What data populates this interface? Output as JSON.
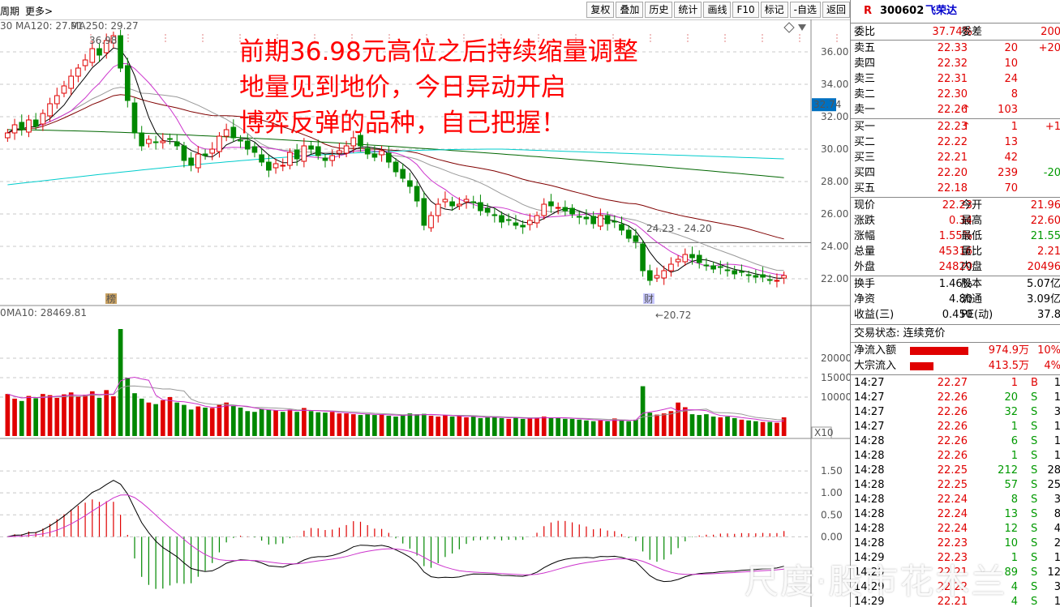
{
  "toolbar": {
    "period_label": "周期",
    "more_label": "更多>",
    "buttons": [
      "复权",
      "叠加",
      "历史",
      "统计",
      "画线",
      "F10",
      "标记",
      "-自选",
      "返回"
    ]
  },
  "ma_legend": {
    "first": "30",
    "ma120": "MA120: 27.91",
    "ma250": "MA250: 29.27"
  },
  "vol_legend": {
    "first": "0",
    "ma10": "MA10: 28469.81",
    "badge": "X10"
  },
  "price_axis": [
    "36.00",
    "34.00",
    "32.00",
    "30.00",
    "28.00",
    "26.00",
    "24.00",
    "22.00"
  ],
  "current_price_tag": "32.74",
  "vol_axis": [
    "20000",
    "15000",
    "10000"
  ],
  "macd_axis": [
    "1.50",
    "1.00",
    "0.50",
    "0.00"
  ],
  "chart_annotations": {
    "high_label": "36.98",
    "low_label": "←20.72",
    "range_label": "24.23 - 24.20",
    "bang_marker": "榜",
    "cai_marker": "财"
  },
  "annotation_text": [
    "前期36.98元高位之后持续缩量调整",
    "地量见到地价，今日异动开启",
    "博弈反弹的品种，自己把握！"
  ],
  "watermark": "尺度·股市花木兰",
  "stock": {
    "code": "300602",
    "name": "飞荣达",
    "badge": "R"
  },
  "ratio": {
    "l1": "委比",
    "v1": "37.74%",
    "l2": "委差",
    "v2": "200"
  },
  "sells": [
    {
      "label": "卖五",
      "price": "22.33",
      "vol": "20",
      "chg": "+20"
    },
    {
      "label": "卖四",
      "price": "22.32",
      "vol": "10",
      "chg": ""
    },
    {
      "label": "卖三",
      "price": "22.31",
      "vol": "24",
      "chg": ""
    },
    {
      "label": "卖二",
      "price": "22.30",
      "vol": "8",
      "chg": ""
    },
    {
      "label": "卖一",
      "price": "22.26",
      "vol": "103",
      "chg": "",
      "arrow": "↑"
    }
  ],
  "buys": [
    {
      "label": "买一",
      "price": "22.23",
      "vol": "1",
      "chg": "+1",
      "arrow": "↑"
    },
    {
      "label": "买二",
      "price": "22.22",
      "vol": "13",
      "chg": ""
    },
    {
      "label": "买三",
      "price": "22.21",
      "vol": "42",
      "chg": ""
    },
    {
      "label": "买四",
      "price": "22.20",
      "vol": "239",
      "chg": "-20"
    },
    {
      "label": "买五",
      "price": "22.18",
      "vol": "70",
      "chg": ""
    }
  ],
  "quote": [
    {
      "l1": "现价",
      "v1": "22.23",
      "l2": "今开",
      "v2": "21.96"
    },
    {
      "l1": "涨跌",
      "v1": "0.34",
      "l2": "最高",
      "v2": "22.60"
    },
    {
      "l1": "涨幅",
      "v1": "1.55%",
      "l2": "最低",
      "v2": "21.55"
    },
    {
      "l1": "总量",
      "v1": "45316",
      "l2": "量比",
      "v2": "2.21"
    },
    {
      "l1": "外盘",
      "v1": "24820",
      "l2": "内盘",
      "v2": "20496"
    }
  ],
  "fund": [
    {
      "l1": "换手",
      "v1": "1.46%",
      "l2": "股本",
      "v2": "5.07亿"
    },
    {
      "l1": "净资",
      "v1": "4.80",
      "l2": "流通",
      "v2": "3.09亿"
    },
    {
      "l1": "收益(三)",
      "v1": "0.450",
      "l2": "PE(动)",
      "v2": "37.8"
    }
  ],
  "trade_status": "交易状态: 连续竞价",
  "flows": [
    {
      "label": "净流入额",
      "value": "974.9万",
      "pct": "10%",
      "bar": 0.55
    },
    {
      "label": "大宗流入",
      "value": "413.5万",
      "pct": "4%",
      "bar": 0.22
    }
  ],
  "ticks": [
    {
      "t": "14:27",
      "p": "22.27",
      "v": "1",
      "s": "B",
      "x": "1"
    },
    {
      "t": "14:27",
      "p": "22.26",
      "v": "20",
      "s": "S",
      "x": "1"
    },
    {
      "t": "14:27",
      "p": "22.26",
      "v": "32",
      "s": "S",
      "x": "3"
    },
    {
      "t": "14:27",
      "p": "22.26",
      "v": "1",
      "s": "S",
      "x": "1"
    },
    {
      "t": "14:28",
      "p": "22.26",
      "v": "6",
      "s": "S",
      "x": "1"
    },
    {
      "t": "14:28",
      "p": "22.26",
      "v": "1",
      "s": "S",
      "x": "1"
    },
    {
      "t": "14:28",
      "p": "22.25",
      "v": "212",
      "s": "S",
      "x": "28"
    },
    {
      "t": "14:28",
      "p": "22.25",
      "v": "57",
      "s": "S",
      "x": "25"
    },
    {
      "t": "14:28",
      "p": "22.24",
      "v": "8",
      "s": "S",
      "x": "3"
    },
    {
      "t": "14:28",
      "p": "22.24",
      "v": "13",
      "s": "S",
      "x": "8"
    },
    {
      "t": "14:28",
      "p": "22.24",
      "v": "12",
      "s": "S",
      "x": "4"
    },
    {
      "t": "14:28",
      "p": "22.23",
      "v": "10",
      "s": "S",
      "x": "2"
    },
    {
      "t": "14:29",
      "p": "22.23",
      "v": "1",
      "s": "S",
      "x": "1"
    },
    {
      "t": "14:29",
      "p": "22.21",
      "v": "89",
      "s": "S",
      "x": "12"
    },
    {
      "t": "14:29",
      "p": "22.22",
      "v": "4",
      "s": "S",
      "x": "3"
    },
    {
      "t": "14:29",
      "p": "22.21",
      "v": "4",
      "s": "S",
      "x": "1"
    }
  ],
  "chart_data": {
    "type": "candlestick",
    "title": "",
    "ylim": [
      20.5,
      37.5
    ],
    "close": [
      31.0,
      31.5,
      31.2,
      31.8,
      31.4,
      32.2,
      32.8,
      33.3,
      33.9,
      34.5,
      35.0,
      35.5,
      36.2,
      35.8,
      36.7,
      37.0,
      35.0,
      33.0,
      31.0,
      30.2,
      30.6,
      30.4,
      30.5,
      30.6,
      30.2,
      29.3,
      29.0,
      29.7,
      29.6,
      30.0,
      30.8,
      31.2,
      30.7,
      30.5,
      30.0,
      29.8,
      29.2,
      28.7,
      29.1,
      29.0,
      29.8,
      29.4,
      30.2,
      30.0,
      29.6,
      29.3,
      29.6,
      29.9,
      30.2,
      30.7,
      30.2,
      29.7,
      29.5,
      29.9,
      29.2,
      28.6,
      28.2,
      27.7,
      26.8,
      25.3,
      25.9,
      26.6,
      26.9,
      26.5,
      26.6,
      26.9,
      26.7,
      26.2,
      26.1,
      25.9,
      25.5,
      25.6,
      25.3,
      25.2,
      25.6,
      25.9,
      26.6,
      26.5,
      26.4,
      26.2,
      26.0,
      25.8,
      25.7,
      25.4,
      25.9,
      25.4,
      25.5,
      25.0,
      24.5,
      24.3,
      22.5,
      21.9,
      22.2,
      22.5,
      22.9,
      23.2,
      23.5,
      23.3,
      23.0,
      22.8,
      22.6,
      22.7,
      22.5,
      22.3,
      22.4,
      22.2,
      22.1,
      22.1,
      21.9,
      21.9,
      22.2
    ],
    "volume": [
      10800,
      9600,
      9000,
      10300,
      9700,
      10800,
      10500,
      9800,
      10700,
      11200,
      10100,
      10600,
      11500,
      9800,
      11800,
      10200,
      27500,
      15000,
      11000,
      9600,
      8600,
      8200,
      9200,
      10000,
      8600,
      8000,
      6800,
      7600,
      7300,
      7200,
      8000,
      8600,
      7800,
      7300,
      6400,
      6200,
      7000,
      6800,
      6600,
      6200,
      6800,
      6200,
      7200,
      6400,
      6100,
      6000,
      6200,
      5800,
      5800,
      5600,
      5400,
      5600,
      5400,
      5600,
      5200,
      5000,
      5400,
      5800,
      5600,
      5700,
      5200,
      5000,
      5400,
      5000,
      5100,
      4800,
      5000,
      4600,
      4800,
      5000,
      4600,
      4400,
      4800,
      4400,
      4500,
      4800,
      5000,
      4600,
      4600,
      4400,
      4400,
      4200,
      4000,
      3800,
      4000,
      3800,
      4500,
      4000,
      3800,
      4200,
      12800,
      6000,
      5500,
      5800,
      6400,
      8600,
      7400,
      5600,
      5400,
      5600,
      5000,
      4800,
      5000,
      4600,
      4200,
      4000,
      3800,
      3600,
      3600,
      3400,
      4800
    ],
    "events": [
      {
        "label": "36.98",
        "type": "high"
      },
      {
        "label": "20.72",
        "type": "low"
      },
      {
        "label": "24.23 - 24.20",
        "type": "range"
      }
    ]
  }
}
